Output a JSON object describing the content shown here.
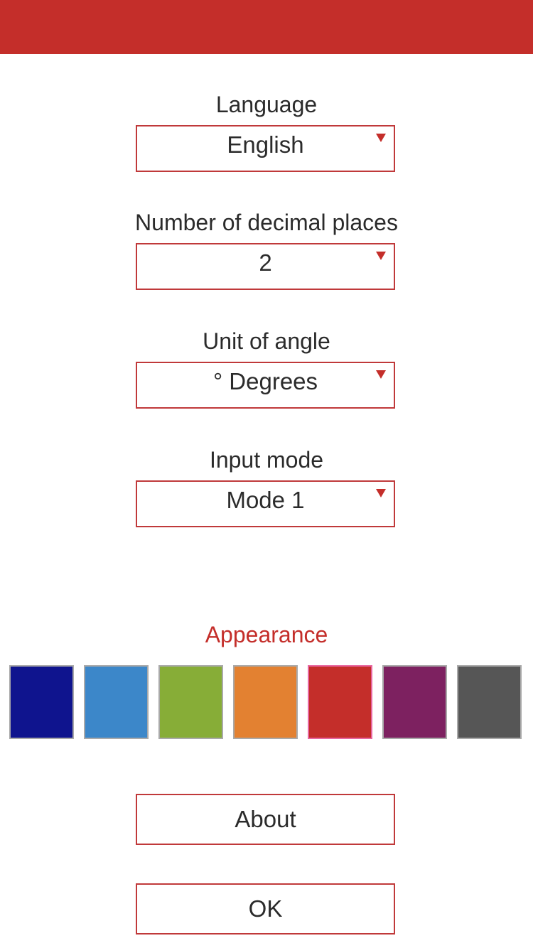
{
  "header": {
    "color": "#c42e2a"
  },
  "settings": {
    "fields": [
      {
        "label": "Language",
        "value": "English"
      },
      {
        "label": "Number of decimal places",
        "value": "2"
      },
      {
        "label": "Unit of angle",
        "value": "° Degrees"
      },
      {
        "label": "Input mode",
        "value": "Mode 1"
      }
    ],
    "dropdown_icon": "triangle-down-icon"
  },
  "appearance": {
    "label": "Appearance",
    "selected_index": 4,
    "swatches": [
      {
        "name": "dark-blue",
        "color": "#0f148e"
      },
      {
        "name": "light-blue",
        "color": "#3c87c9"
      },
      {
        "name": "green",
        "color": "#87ad37"
      },
      {
        "name": "orange",
        "color": "#e38131"
      },
      {
        "name": "red",
        "color": "#c42e2a"
      },
      {
        "name": "purple",
        "color": "#7d2160"
      },
      {
        "name": "gray",
        "color": "#565656"
      }
    ]
  },
  "buttons": {
    "about_label": "About",
    "ok_label": "OK"
  },
  "colors": {
    "accent": "#c42e2a",
    "selected_border": "#e7669f",
    "swatch_border": "#a9a9a9",
    "text": "#2b2b2b"
  }
}
